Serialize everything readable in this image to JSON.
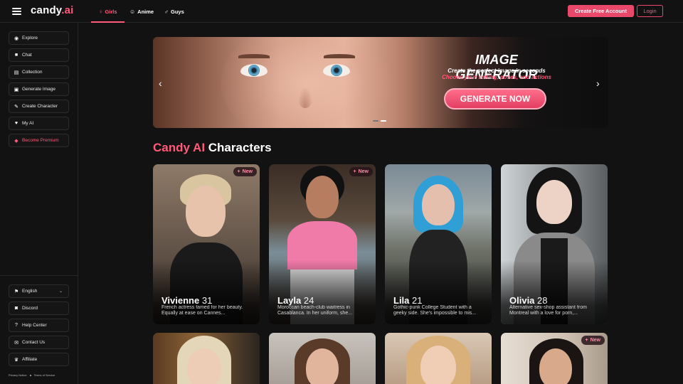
{
  "header": {
    "logo": "candy",
    "logo_suffix": ".ai",
    "tabs": [
      {
        "label": "Girls",
        "icon": "female-icon"
      },
      {
        "label": "Anime",
        "icon": "anime-icon"
      },
      {
        "label": "Guys",
        "icon": "male-icon"
      }
    ],
    "create_account_label": "Create Free Account",
    "login_label": "Login"
  },
  "sidebar": {
    "items": [
      {
        "label": "Explore",
        "icon": "compass-icon",
        "glyph": "◉"
      },
      {
        "label": "Chat",
        "icon": "chat-icon",
        "glyph": "💬"
      },
      {
        "label": "Collection",
        "icon": "collection-icon",
        "glyph": "▤"
      },
      {
        "label": "Generate Image",
        "icon": "image-icon",
        "glyph": "🖼"
      },
      {
        "label": "Create Character",
        "icon": "wand-icon",
        "glyph": "✎"
      },
      {
        "label": "My AI",
        "icon": "heart-icon",
        "glyph": "♥"
      },
      {
        "label": "Become Premium",
        "icon": "diamond-icon",
        "glyph": "◆"
      }
    ],
    "bottom_items": [
      {
        "label": "English",
        "icon": "flag-icon",
        "glyph": "⚑"
      },
      {
        "label": "Discord",
        "icon": "discord-icon",
        "glyph": "◙"
      },
      {
        "label": "Help Center",
        "icon": "help-icon",
        "glyph": "?"
      },
      {
        "label": "Contact Us",
        "icon": "contact-icon",
        "glyph": "✉"
      },
      {
        "label": "Affiliate",
        "icon": "trophy-icon",
        "glyph": "♛"
      }
    ],
    "footer_links": [
      "Privacy Notice",
      "Terms of Service"
    ]
  },
  "banner": {
    "title": "IMAGE GENERATOR",
    "subtitle1": "Create the perfect image in seconds",
    "subtitle2": "Choose your setting, poses, and actions",
    "cta": "GENERATE NOW",
    "prev": "‹",
    "next": "›"
  },
  "section": {
    "heading_accent": "Candy AI",
    "heading_rest": " Characters"
  },
  "badge_label": "New",
  "characters": [
    {
      "name": "Vivienne",
      "age": "31",
      "desc": "French actress famed for her beauty. Equally at ease on Cannes...",
      "new": true
    },
    {
      "name": "Layla",
      "age": "24",
      "desc": "Moroccan beach-club waitress in Casablanca. In her uniform, she...",
      "new": true
    },
    {
      "name": "Lila",
      "age": "21",
      "desc": "Gothic-punk College Student with a geeky side. She's impossible to mis...",
      "new": false
    },
    {
      "name": "Olivia",
      "age": "28",
      "desc": "Alternative sex-shop assistant from Montreal with a love for porn,...",
      "new": false
    }
  ],
  "colors": {
    "accent": "#ff5a79",
    "button": "#e9486a",
    "background": "#121212"
  }
}
